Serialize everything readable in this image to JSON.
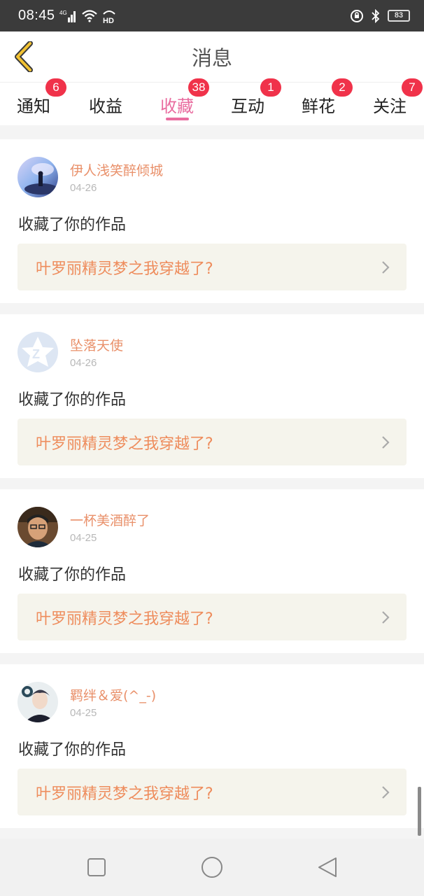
{
  "status_bar": {
    "time": "08:45",
    "network": "4G",
    "hd": "HD",
    "battery": "83",
    "icons": [
      "signal-icon",
      "wifi-icon",
      "hd-icon",
      "alarm-icon",
      "bluetooth-icon",
      "battery-icon"
    ]
  },
  "header": {
    "back_icon": "chevron-left-icon",
    "title": "消息"
  },
  "tabs": [
    {
      "label": "通知",
      "badge": "6",
      "active": false
    },
    {
      "label": "收益",
      "badge": "",
      "active": false
    },
    {
      "label": "收藏",
      "badge": "38",
      "active": true
    },
    {
      "label": "互动",
      "badge": "1",
      "active": false
    },
    {
      "label": "鲜花",
      "badge": "2",
      "active": false
    },
    {
      "label": "关注",
      "badge": "7",
      "active": false
    }
  ],
  "colors": {
    "accent": "#e96c9f",
    "badge": "#f0324a",
    "username": "#e9906a",
    "work_title": "#ee8c5c",
    "work_bg": "#f5f4ec"
  },
  "messages": [
    {
      "username": "伊人浅笑醉倾城",
      "date": "04-26",
      "action": "收藏了你的作品",
      "work_title": "叶罗丽精灵梦之我穿越了?"
    },
    {
      "username": "坠落天使",
      "date": "04-26",
      "action": "收藏了你的作品",
      "work_title": "叶罗丽精灵梦之我穿越了?"
    },
    {
      "username": "一杯美酒醉了",
      "date": "04-25",
      "action": "收藏了你的作品",
      "work_title": "叶罗丽精灵梦之我穿越了?"
    },
    {
      "username": "羁绊＆爱(^_-)",
      "date": "04-25",
      "action": "收藏了你的作品",
      "work_title": "叶罗丽精灵梦之我穿越了?"
    }
  ],
  "nav_bar": {
    "icons": [
      "recents-square-icon",
      "home-circle-icon",
      "back-triangle-icon"
    ]
  }
}
